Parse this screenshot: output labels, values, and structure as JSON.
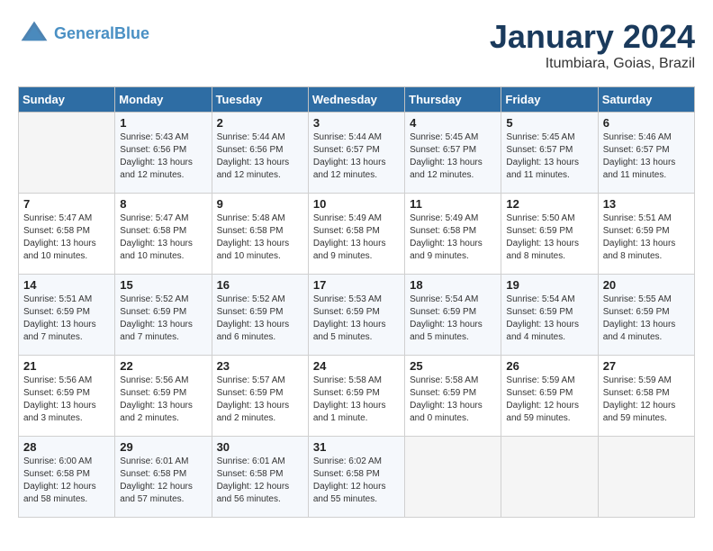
{
  "header": {
    "logo_line1": "General",
    "logo_line2": "Blue",
    "month_title": "January 2024",
    "location": "Itumbiara, Goias, Brazil"
  },
  "days_of_week": [
    "Sunday",
    "Monday",
    "Tuesday",
    "Wednesday",
    "Thursday",
    "Friday",
    "Saturday"
  ],
  "weeks": [
    [
      {
        "day": "",
        "empty": true
      },
      {
        "day": "1",
        "sunrise": "5:43 AM",
        "sunset": "6:56 PM",
        "daylight": "13 hours and 12 minutes."
      },
      {
        "day": "2",
        "sunrise": "5:44 AM",
        "sunset": "6:56 PM",
        "daylight": "13 hours and 12 minutes."
      },
      {
        "day": "3",
        "sunrise": "5:44 AM",
        "sunset": "6:57 PM",
        "daylight": "13 hours and 12 minutes."
      },
      {
        "day": "4",
        "sunrise": "5:45 AM",
        "sunset": "6:57 PM",
        "daylight": "13 hours and 12 minutes."
      },
      {
        "day": "5",
        "sunrise": "5:45 AM",
        "sunset": "6:57 PM",
        "daylight": "13 hours and 11 minutes."
      },
      {
        "day": "6",
        "sunrise": "5:46 AM",
        "sunset": "6:57 PM",
        "daylight": "13 hours and 11 minutes."
      }
    ],
    [
      {
        "day": "7",
        "sunrise": "5:47 AM",
        "sunset": "6:58 PM",
        "daylight": "13 hours and 10 minutes."
      },
      {
        "day": "8",
        "sunrise": "5:47 AM",
        "sunset": "6:58 PM",
        "daylight": "13 hours and 10 minutes."
      },
      {
        "day": "9",
        "sunrise": "5:48 AM",
        "sunset": "6:58 PM",
        "daylight": "13 hours and 10 minutes."
      },
      {
        "day": "10",
        "sunrise": "5:49 AM",
        "sunset": "6:58 PM",
        "daylight": "13 hours and 9 minutes."
      },
      {
        "day": "11",
        "sunrise": "5:49 AM",
        "sunset": "6:58 PM",
        "daylight": "13 hours and 9 minutes."
      },
      {
        "day": "12",
        "sunrise": "5:50 AM",
        "sunset": "6:59 PM",
        "daylight": "13 hours and 8 minutes."
      },
      {
        "day": "13",
        "sunrise": "5:51 AM",
        "sunset": "6:59 PM",
        "daylight": "13 hours and 8 minutes."
      }
    ],
    [
      {
        "day": "14",
        "sunrise": "5:51 AM",
        "sunset": "6:59 PM",
        "daylight": "13 hours and 7 minutes."
      },
      {
        "day": "15",
        "sunrise": "5:52 AM",
        "sunset": "6:59 PM",
        "daylight": "13 hours and 7 minutes."
      },
      {
        "day": "16",
        "sunrise": "5:52 AM",
        "sunset": "6:59 PM",
        "daylight": "13 hours and 6 minutes."
      },
      {
        "day": "17",
        "sunrise": "5:53 AM",
        "sunset": "6:59 PM",
        "daylight": "13 hours and 5 minutes."
      },
      {
        "day": "18",
        "sunrise": "5:54 AM",
        "sunset": "6:59 PM",
        "daylight": "13 hours and 5 minutes."
      },
      {
        "day": "19",
        "sunrise": "5:54 AM",
        "sunset": "6:59 PM",
        "daylight": "13 hours and 4 minutes."
      },
      {
        "day": "20",
        "sunrise": "5:55 AM",
        "sunset": "6:59 PM",
        "daylight": "13 hours and 4 minutes."
      }
    ],
    [
      {
        "day": "21",
        "sunrise": "5:56 AM",
        "sunset": "6:59 PM",
        "daylight": "13 hours and 3 minutes."
      },
      {
        "day": "22",
        "sunrise": "5:56 AM",
        "sunset": "6:59 PM",
        "daylight": "13 hours and 2 minutes."
      },
      {
        "day": "23",
        "sunrise": "5:57 AM",
        "sunset": "6:59 PM",
        "daylight": "13 hours and 2 minutes."
      },
      {
        "day": "24",
        "sunrise": "5:58 AM",
        "sunset": "6:59 PM",
        "daylight": "13 hours and 1 minute."
      },
      {
        "day": "25",
        "sunrise": "5:58 AM",
        "sunset": "6:59 PM",
        "daylight": "13 hours and 0 minutes."
      },
      {
        "day": "26",
        "sunrise": "5:59 AM",
        "sunset": "6:59 PM",
        "daylight": "12 hours and 59 minutes."
      },
      {
        "day": "27",
        "sunrise": "5:59 AM",
        "sunset": "6:58 PM",
        "daylight": "12 hours and 59 minutes."
      }
    ],
    [
      {
        "day": "28",
        "sunrise": "6:00 AM",
        "sunset": "6:58 PM",
        "daylight": "12 hours and 58 minutes."
      },
      {
        "day": "29",
        "sunrise": "6:01 AM",
        "sunset": "6:58 PM",
        "daylight": "12 hours and 57 minutes."
      },
      {
        "day": "30",
        "sunrise": "6:01 AM",
        "sunset": "6:58 PM",
        "daylight": "12 hours and 56 minutes."
      },
      {
        "day": "31",
        "sunrise": "6:02 AM",
        "sunset": "6:58 PM",
        "daylight": "12 hours and 55 minutes."
      },
      {
        "day": "",
        "empty": true
      },
      {
        "day": "",
        "empty": true
      },
      {
        "day": "",
        "empty": true
      }
    ]
  ]
}
